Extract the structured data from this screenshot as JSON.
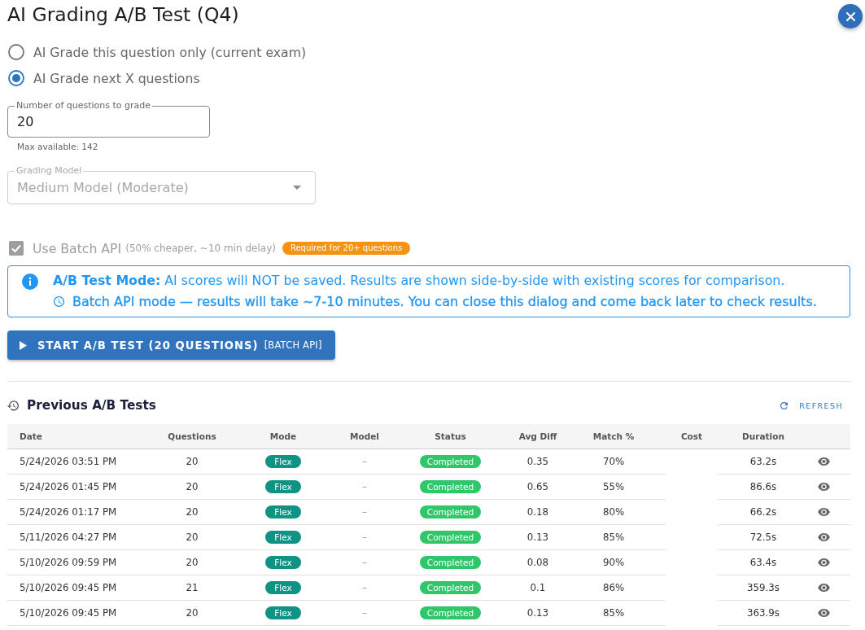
{
  "dialog": {
    "title": "AI Grading A/B Test (Q4)"
  },
  "grading_scope": [
    {
      "label": "AI Grade this question only (current exam)",
      "selected": false
    },
    {
      "label": "AI Grade next X questions",
      "selected": true
    }
  ],
  "question_count_field": {
    "label": "Number of questions to grade",
    "value": "20",
    "helper": "Max available: 142"
  },
  "model_select": {
    "label": "Grading Model",
    "value": "Medium Model (Moderate)",
    "disabled": true
  },
  "batch_api": {
    "label": "Use Batch API",
    "note": "(50% cheaper, ~10 min delay)",
    "checked": true,
    "disabled": true,
    "badge": "Required for 20+ questions"
  },
  "alert": {
    "message": "**A/B Test Mode:** AI scores will NOT be saved. Results are shown side-by-side with existing scores for comparison.",
    "batch_note": "Batch API mode — results will take ~7-10 minutes. You can close this dialog and come back later to check results."
  },
  "start_button": {
    "label": "START A/B TEST (20 QUESTIONS)",
    "tag": "[BATCH API]"
  },
  "history": {
    "title": "Previous A/B Tests",
    "refresh_label": "REFRESH",
    "table": {
      "columns": [
        "Date",
        "Questions",
        "Mode",
        "Model",
        "Status",
        "Avg Diff",
        "Match %",
        "Cost",
        "Duration"
      ],
      "rows": [
        {
          "date": "5/24/2026 03:51 PM",
          "questions": "20",
          "mode": "Flex",
          "model": "–",
          "status": "Completed",
          "avg_diff": "0.35",
          "match": "70%",
          "duration": "63.2s"
        },
        {
          "date": "5/24/2026 01:45 PM",
          "questions": "20",
          "mode": "Flex",
          "model": "–",
          "status": "Completed",
          "avg_diff": "0.65",
          "match": "55%",
          "duration": "86.6s"
        },
        {
          "date": "5/24/2026 01:17 PM",
          "questions": "20",
          "mode": "Flex",
          "model": "–",
          "status": "Completed",
          "avg_diff": "0.18",
          "match": "80%",
          "duration": "66.2s"
        },
        {
          "date": "5/11/2026 04:27 PM",
          "questions": "20",
          "mode": "Flex",
          "model": "–",
          "status": "Completed",
          "avg_diff": "0.13",
          "match": "85%",
          "duration": "72.5s"
        },
        {
          "date": "5/10/2026 09:59 PM",
          "questions": "20",
          "mode": "Flex",
          "model": "–",
          "status": "Completed",
          "avg_diff": "0.08",
          "match": "90%",
          "duration": "63.4s"
        },
        {
          "date": "5/10/2026 09:45 PM",
          "questions": "21",
          "mode": "Flex",
          "model": "–",
          "status": "Completed",
          "avg_diff": "0.1",
          "match": "86%",
          "duration": "359.3s"
        },
        {
          "date": "5/10/2026 09:45 PM",
          "questions": "20",
          "mode": "Flex",
          "model": "–",
          "status": "Completed",
          "avg_diff": "0.13",
          "match": "85%",
          "duration": "363.9s"
        }
      ]
    }
  }
}
